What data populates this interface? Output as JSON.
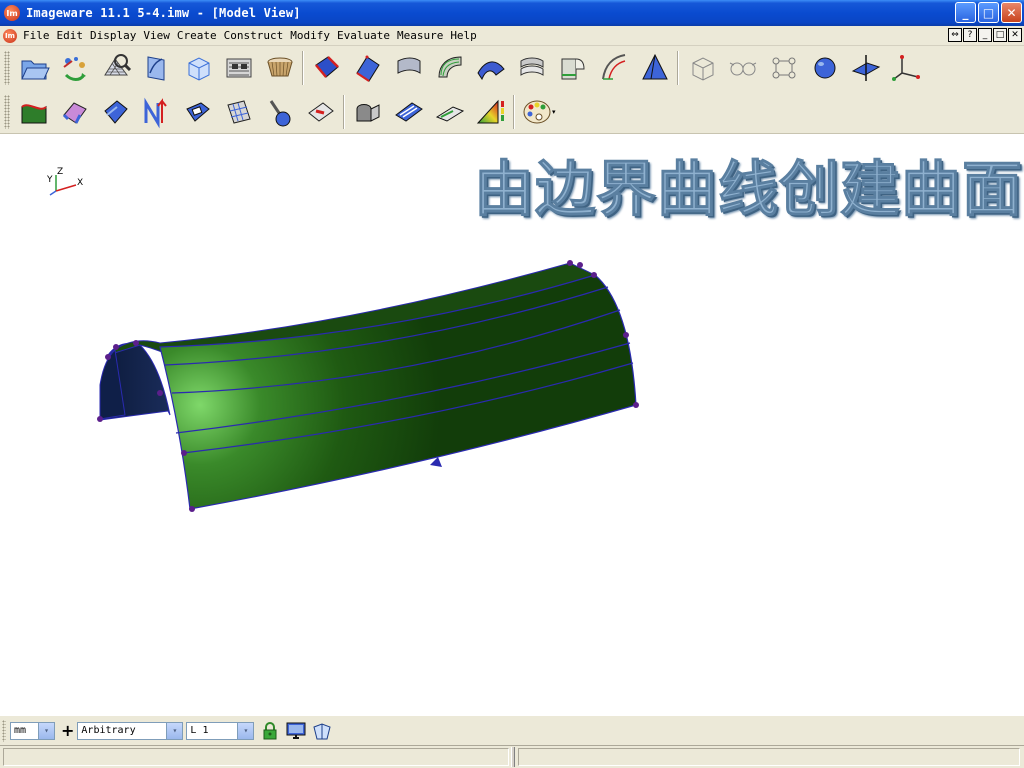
{
  "window": {
    "title": "Imageware 11.1    5-4.imw - [Model View]",
    "app_icon_label": "Im",
    "buttons": {
      "minimize": "_",
      "maximize": "□",
      "close": "✕"
    }
  },
  "menubar": {
    "icon_label": "Im",
    "items": [
      {
        "label": "File"
      },
      {
        "label": "Edit"
      },
      {
        "label": "Display"
      },
      {
        "label": "View"
      },
      {
        "label": "Create"
      },
      {
        "label": "Construct"
      },
      {
        "label": "Modify"
      },
      {
        "label": "Evaluate"
      },
      {
        "label": "Measure"
      },
      {
        "label": "Help"
      }
    ],
    "mdi_buttons": [
      "⇔",
      "?",
      "_",
      "□",
      "✕"
    ]
  },
  "toolbar": {
    "row1_icons": [
      "open-file-icon",
      "import-cloud-icon",
      "scan-mesh-icon",
      "curve-sketch-icon",
      "cube-icon",
      "scan-lines-icon",
      "cup-surface-icon",
      "surface-red-icon",
      "surface-blue-diamond-icon",
      "surface-sweep-icon",
      "surface-blend-icon",
      "surface-loft-icon",
      "surface-offset-icon",
      "surface-fillet-icon",
      "surface-curve-icon",
      "pyramid-icon",
      "wireframe-box-icon",
      "wireframe-glasses-icon",
      "node-network-icon",
      "sphere-tool-icon",
      "plane-icon",
      "axes-icon"
    ],
    "row2_icons": [
      "curvature-surface-icon",
      "surface-network-icon",
      "surface-patch-icon",
      "normal-arrow-icon",
      "ring-surface-icon",
      "grid-surface-icon",
      "probe-icon",
      "trim-surface-icon",
      "mailbox-surface-icon",
      "stripe-surface-icon",
      "flat-surface-icon",
      "color-map-icon",
      "palette-icon"
    ],
    "palette_dropdown": "▾"
  },
  "viewport": {
    "overlay_title": "由边界曲线创建曲面",
    "triad": {
      "x": "X",
      "y": "Y",
      "z": "Z"
    },
    "colors": {
      "surface": "#1f5a12",
      "highlight": "#7fd86a",
      "curves": "#2a2ab0",
      "points": "#5b1f8c"
    }
  },
  "bottombar": {
    "units": {
      "value": "mm",
      "arrow": "▾"
    },
    "plus": "+",
    "plane": {
      "value": "Arbitrary",
      "arrow": "▾"
    },
    "layer": {
      "value": "L 1",
      "arrow": "▾"
    }
  },
  "statusbar": {
    "pane1": "",
    "pane2": ""
  }
}
